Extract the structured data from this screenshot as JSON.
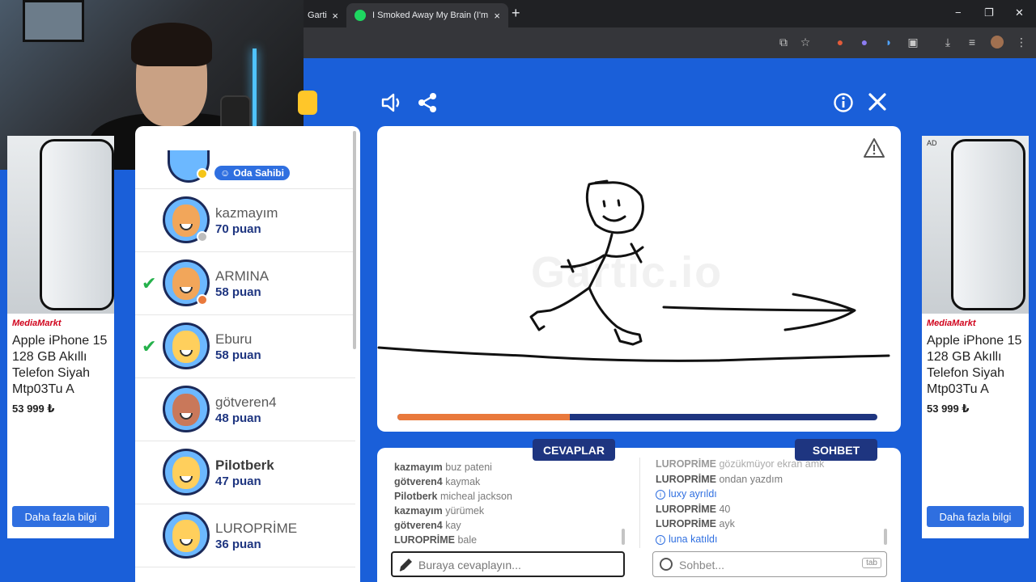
{
  "browser": {
    "tab1_title": "Gartic",
    "tab2_title": "I Smoked Away My Brain (I'm God x Ani",
    "tab_close": "×",
    "new_tab": "+",
    "minimize": "−",
    "maximize": "❐",
    "close": "✕"
  },
  "ads": {
    "brand": "MediaMarkt",
    "title": "Apple iPhone 15 128 GB Akıllı Telefon Siyah Mtp03Tu A",
    "price": "53 999 ₺",
    "button": "Daha fazla bilgi",
    "ad_label": "AD"
  },
  "players": {
    "owner_badge": "Oda Sahibi",
    "list": [
      {
        "name": "kazmayım",
        "score": "70 puan",
        "checked": false,
        "dot": "#bdbdbd",
        "skin": "#f2a65a",
        "bold": false
      },
      {
        "name": "ARMINA",
        "score": "58 puan",
        "checked": true,
        "dot": "#e9793c",
        "skin": "#f2a65a",
        "bold": false
      },
      {
        "name": "Eburu",
        "score": "58 puan",
        "checked": true,
        "dot": "",
        "skin": "#ffcf5c",
        "bold": false
      },
      {
        "name": "götveren4",
        "score": "48 puan",
        "checked": false,
        "dot": "",
        "skin": "#c9785a",
        "bold": false
      },
      {
        "name": "Pilotberk",
        "score": "47 puan",
        "checked": false,
        "dot": "",
        "skin": "#ffcf5c",
        "bold": true
      },
      {
        "name": "LUROPRİME",
        "score": "36 puan",
        "checked": false,
        "dot": "",
        "skin": "#ffcf5c",
        "bold": false
      }
    ]
  },
  "canvas": {
    "watermark": "Gartic.io",
    "timer_progress": 0.36
  },
  "answers": {
    "label": "CEVAPLAR",
    "messages": [
      {
        "user": "kazmayım",
        "text": "buz pateni"
      },
      {
        "user": "götveren4",
        "text": "kaymak"
      },
      {
        "user": "Pilotberk",
        "text": "micheal jackson"
      },
      {
        "user": "kazmayım",
        "text": "yürümek"
      },
      {
        "user": "götveren4",
        "text": "kay"
      },
      {
        "user": "LUROPRİME",
        "text": "bale"
      }
    ],
    "placeholder": "Buraya cevaplayın..."
  },
  "chat": {
    "label": "SOHBET",
    "messages": [
      {
        "user": "LUROPRİME",
        "text": "gözükmüyor ekran amk",
        "system": false,
        "faded": true
      },
      {
        "user": "LUROPRİME",
        "text": "ondan yazdım",
        "system": false,
        "faded": false
      },
      {
        "user": "luxy",
        "text": "ayrıldı",
        "system": true,
        "faded": false
      },
      {
        "user": "LUROPRİME",
        "text": "40",
        "system": false,
        "faded": false
      },
      {
        "user": "LUROPRİME",
        "text": "ayk",
        "system": false,
        "faded": false
      },
      {
        "user": "luna",
        "text": "katıldı",
        "system": true,
        "faded": false
      }
    ],
    "placeholder": "Sohbet...",
    "tab_hint": "tab"
  },
  "colors": {
    "background": "#1a5fd9",
    "primary_dark": "#1e3580",
    "timer_fill": "#e9793c",
    "check": "#25b14b"
  }
}
